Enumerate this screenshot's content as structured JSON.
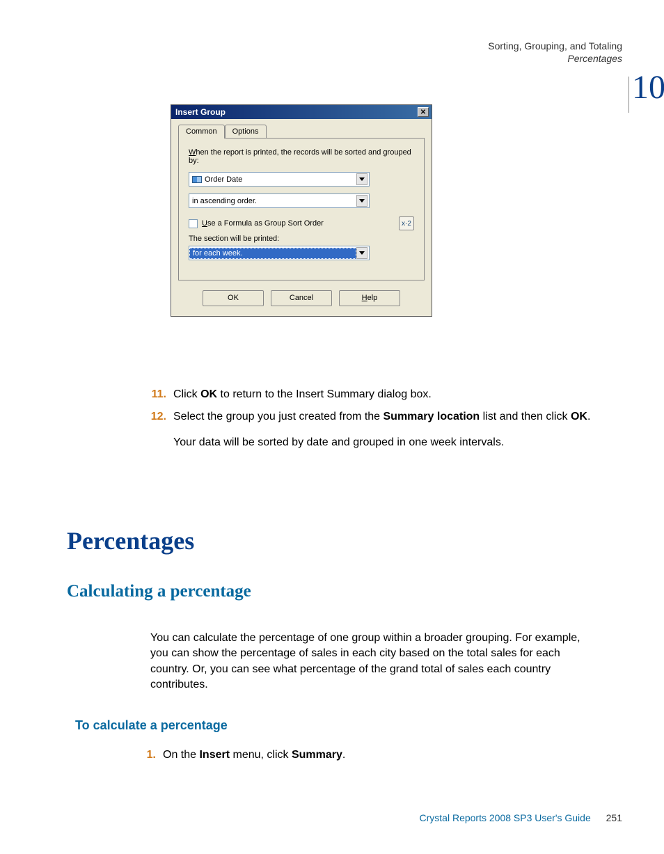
{
  "header": {
    "chapter_title": "Sorting, Grouping, and Totaling",
    "section_title": "Percentages",
    "chapter_number": "10"
  },
  "dialog": {
    "title": "Insert Group",
    "tabs": {
      "common": "Common",
      "options": "Options"
    },
    "instruction_pre": "W",
    "instruction_rest": "hen the report is printed, the records will be sorted and grouped by:",
    "field_value": "Order Date",
    "sort_order": "in ascending order.",
    "formula_check_pre": "U",
    "formula_check_rest": "se a Formula as Group Sort Order",
    "fx_label": "x·2",
    "section_label": "The section will be printed:",
    "section_value": "for each week.",
    "buttons": {
      "ok": "OK",
      "cancel": "Cancel",
      "help_pre": "H",
      "help_rest": "elp"
    }
  },
  "steps": {
    "s11_num": "11.",
    "s11_a": "Click ",
    "s11_b": "OK",
    "s11_c": " to return to the Insert Summary dialog box.",
    "s12_num": "12.",
    "s12_a": "Select the group you just created from the ",
    "s12_b": "Summary location",
    "s12_c": " list and then click ",
    "s12_d": "OK",
    "s12_e": ".",
    "note": "Your data will be sorted by date and grouped in one week intervals."
  },
  "headings": {
    "h1": "Percentages",
    "h2": "Calculating a percentage",
    "h3": "To calculate a percentage"
  },
  "para1": "You can calculate the percentage of one group within a broader grouping. For example, you can show the percentage of sales in each city based on the total sales for each country. Or, you can see what percentage of the grand total of sales each country contributes.",
  "step1": {
    "num": "1.",
    "a": "On the ",
    "b": "Insert",
    "c": " menu, click ",
    "d": "Summary",
    "e": "."
  },
  "footer": {
    "guide": "Crystal Reports 2008 SP3 User's Guide",
    "page": "251"
  }
}
